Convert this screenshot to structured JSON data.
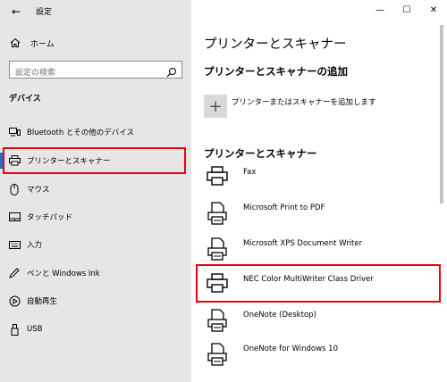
{
  "app": {
    "title": "設定",
    "back_icon": "back-arrow-icon"
  },
  "window_controls": {
    "minimize": "—",
    "maximize": "☐",
    "close": "✕"
  },
  "sidebar": {
    "home_label": "ホーム",
    "search_placeholder": "設定の検索",
    "section_header": "デバイス",
    "items": [
      {
        "label": "Bluetooth とその他のデバイス",
        "icon": "bluetooth-devices-icon"
      },
      {
        "label": "プリンターとスキャナー",
        "icon": "printer-icon",
        "selected": true
      },
      {
        "label": "マウス",
        "icon": "mouse-icon"
      },
      {
        "label": "タッチパッド",
        "icon": "touchpad-icon"
      },
      {
        "label": "入力",
        "icon": "keyboard-icon"
      },
      {
        "label": "ペンと Windows Ink",
        "icon": "pen-icon"
      },
      {
        "label": "自動再生",
        "icon": "autoplay-icon"
      },
      {
        "label": "USB",
        "icon": "usb-icon"
      }
    ]
  },
  "main": {
    "page_title": "プリンターとスキャナー",
    "add_section_title": "プリンターとスキャナーの追加",
    "add_button_label": "プリンターまたはスキャナーを追加します",
    "list_section_title": "プリンターとスキャナー",
    "printers": [
      {
        "name": "Fax",
        "icon": "fax-printer-icon"
      },
      {
        "name": "Microsoft Print to PDF",
        "icon": "document-printer-icon"
      },
      {
        "name": "Microsoft XPS Document Writer",
        "icon": "document-printer-icon"
      },
      {
        "name": "NEC Color MultiWriter Class Driver",
        "icon": "printer-icon",
        "highlighted": true
      },
      {
        "name": "OneNote (Desktop)",
        "icon": "document-printer-icon"
      },
      {
        "name": "OneNote for Windows 10",
        "icon": "document-printer-icon"
      }
    ]
  },
  "colors": {
    "highlight": "#e60012",
    "accent": "#1a73c9",
    "sidebar_bg": "#e6e6e6"
  }
}
